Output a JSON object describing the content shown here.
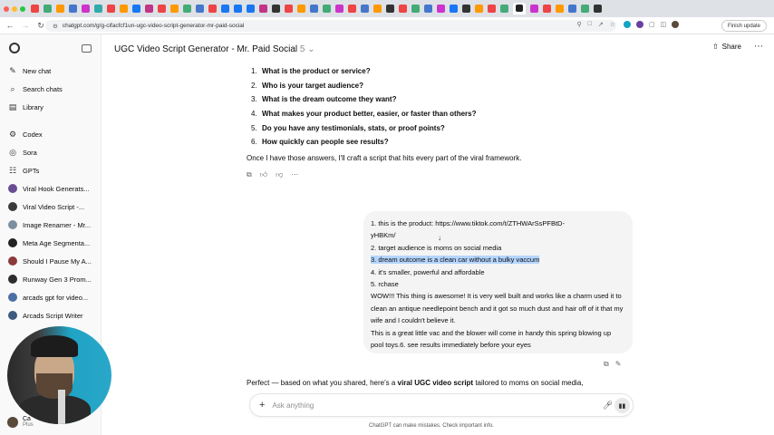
{
  "browser": {
    "url": "chatgpt.com/g/g-cifacfcf1un-ugc-video-script-generator-mr-paid-social",
    "finish_update_label": "Finish update"
  },
  "sidebar": {
    "items": [
      {
        "label": "New chat",
        "icon": "new-chat-icon"
      },
      {
        "label": "Search chats",
        "icon": "search-icon"
      },
      {
        "label": "Library",
        "icon": "library-icon"
      }
    ],
    "apps": [
      {
        "label": "Codex",
        "icon": "codex-icon"
      },
      {
        "label": "Sora",
        "icon": "sora-icon"
      },
      {
        "label": "GPTs",
        "icon": "gpts-icon"
      }
    ],
    "gpts": [
      {
        "label": "Viral Hook Generats...",
        "color": "#6a4c93"
      },
      {
        "label": "Viral Video Script -...",
        "color": "#3a3a3a"
      },
      {
        "label": "Image Renamer - Mr...",
        "color": "#7b8fa1"
      },
      {
        "label": "Meta Age Segmenta...",
        "color": "#222222"
      },
      {
        "label": "Should I Pause My A...",
        "color": "#8b3a3a"
      },
      {
        "label": "Runway Gen 3 Prom...",
        "color": "#2d2d2d"
      },
      {
        "label": "arcads gpt for video...",
        "color": "#4a6fa5"
      },
      {
        "label": "Arcads Script Writer",
        "color": "#3d5a80"
      }
    ],
    "user": {
      "name": "Ca",
      "plan": "Plus"
    }
  },
  "header": {
    "title": "UGC Video Script Generator - Mr. Paid Social",
    "version": "5",
    "share_label": "Share"
  },
  "assistant_questions": [
    {
      "num": "1.",
      "text": "What is the product or service?"
    },
    {
      "num": "2.",
      "text": "Who is your target audience?"
    },
    {
      "num": "3.",
      "text": "What is the dream outcome they want?"
    },
    {
      "num": "4.",
      "text": "What makes your product better, easier, or faster than others?"
    },
    {
      "num": "5.",
      "text": "Do you have any testimonials, stats, or proof points?"
    },
    {
      "num": "6.",
      "text": "How quickly can people see results?"
    }
  ],
  "assistant_followup": "Once I have those answers, I'll craft a script that hits every part of the viral framework.",
  "user_message": {
    "line1": "1. this is the product: https://www.tiktok.com/t/ZTHWArSsPFBtD-",
    "line1b": "yHBKm/",
    "line2": "2. target audience is moms on social media",
    "line3": "3. dream outcome is a clean car without a bulky vaccum",
    "line4": "4. it's smaller, powerful and affordable",
    "line5": "5. rchase",
    "testimonial": "WOW!!! This thing is awesome! It is very well built and works like a charm used it to clean an antique needlepoint bench and it got so much dust and hair off of it that my wife and I couldn't believe it.",
    "testimonial2": "This is a great little vac and the blower will come in handy this spring blowing up pool toys.6. see results immediately before your eyes"
  },
  "response_start": {
    "before": "Perfect — based on what you shared, here's a ",
    "bold": "viral UGC video script",
    "after": " tailored to moms on social media,"
  },
  "composer": {
    "placeholder": "Ask anything"
  },
  "disclaimer": "ChatGPT can make mistakes. Check important info."
}
